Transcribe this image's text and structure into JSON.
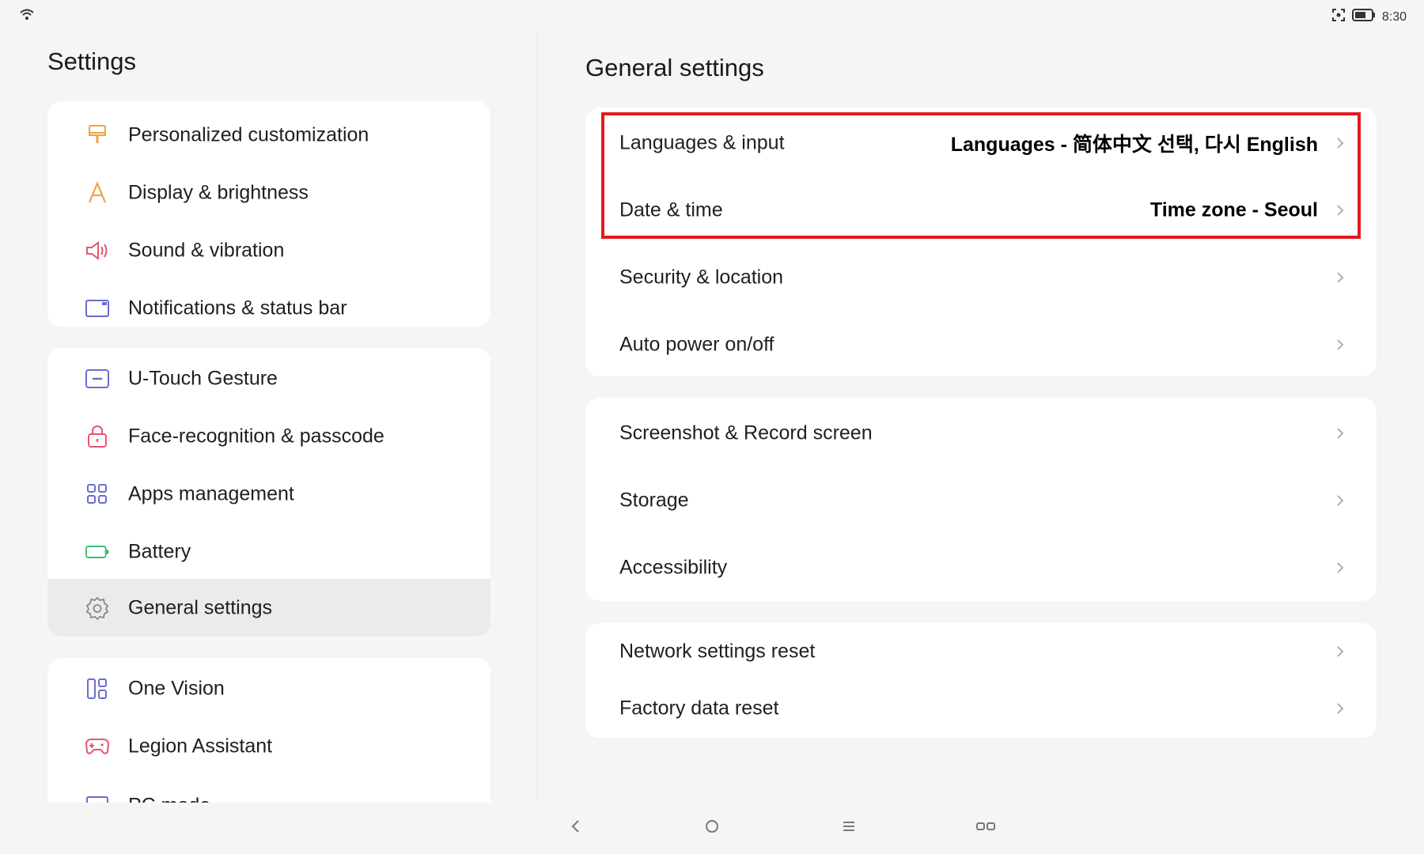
{
  "status_bar": {
    "time": "8:30"
  },
  "left": {
    "title": "Settings",
    "groups": [
      {
        "items": [
          {
            "label": "Personalized customization",
            "icon": "brush-icon"
          },
          {
            "label": "Display & brightness",
            "icon": "display-a-icon"
          },
          {
            "label": "Sound & vibration",
            "icon": "speaker-icon"
          },
          {
            "label": "Notifications & status bar",
            "icon": "notification-icon"
          }
        ]
      },
      {
        "items": [
          {
            "label": "U-Touch Gesture",
            "icon": "gesture-icon"
          },
          {
            "label": "Face-recognition & passcode",
            "icon": "lock-icon"
          },
          {
            "label": "Apps management",
            "icon": "apps-grid-icon"
          },
          {
            "label": "Battery",
            "icon": "battery-icon"
          },
          {
            "label": "General settings",
            "icon": "gear-icon",
            "selected": true
          }
        ]
      },
      {
        "items": [
          {
            "label": "One Vision",
            "icon": "layout-icon"
          },
          {
            "label": "Legion Assistant",
            "icon": "gamepad-icon"
          },
          {
            "label": "PC mode",
            "icon": "pc-icon"
          }
        ]
      }
    ]
  },
  "right": {
    "title": "General settings",
    "groups": [
      {
        "items": [
          {
            "label": "Languages & input",
            "value": "Languages - 简体中文 선택, 다시 English"
          },
          {
            "label": "Date & time",
            "value": "Time zone - Seoul"
          },
          {
            "label": "Security & location"
          },
          {
            "label": "Auto power on/off"
          }
        ]
      },
      {
        "items": [
          {
            "label": "Screenshot & Record screen"
          },
          {
            "label": "Storage"
          },
          {
            "label": "Accessibility"
          }
        ]
      },
      {
        "items": [
          {
            "label": "Network settings reset"
          },
          {
            "label": "Factory data reset"
          }
        ]
      }
    ]
  },
  "colors": {
    "highlight": "#e3191f",
    "accent_icon": "#6b6bd6"
  }
}
